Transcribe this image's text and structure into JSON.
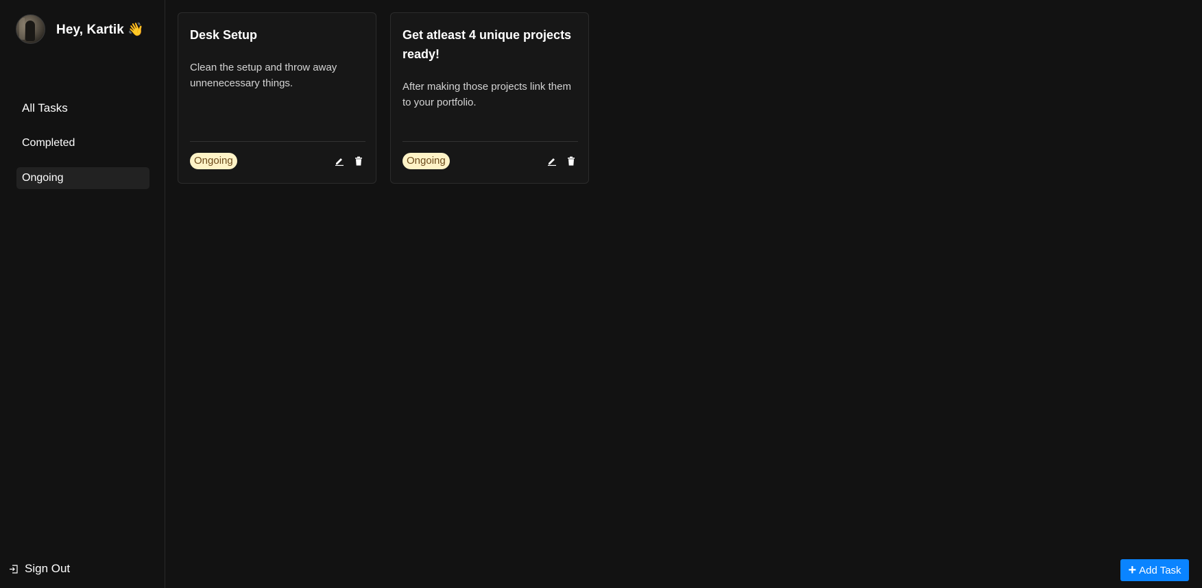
{
  "sidebar": {
    "greeting": "Hey, Kartik 👋",
    "nav": [
      {
        "label": "All Tasks",
        "active": false
      },
      {
        "label": "Completed",
        "active": false
      },
      {
        "label": "Ongoing",
        "active": true
      }
    ],
    "signout_label": "Sign Out"
  },
  "tasks": [
    {
      "title": "Desk Setup",
      "description": "Clean the setup and throw away unnenecessary things.",
      "status": "Ongoing"
    },
    {
      "title": "Get atleast 4 unique projects ready!",
      "description": "After making those projects link them to your portfolio.",
      "status": "Ongoing"
    }
  ],
  "add_task_label": "Add Task",
  "colors": {
    "background": "#121212",
    "card": "#171717",
    "status_badge_bg": "#fef3c7",
    "status_badge_text": "#6b4a1b",
    "accent": "#0a84ff"
  },
  "icons": {
    "edit": "pencil-icon",
    "delete": "trash-icon",
    "signout": "sign-out-icon",
    "add": "plus-icon"
  }
}
